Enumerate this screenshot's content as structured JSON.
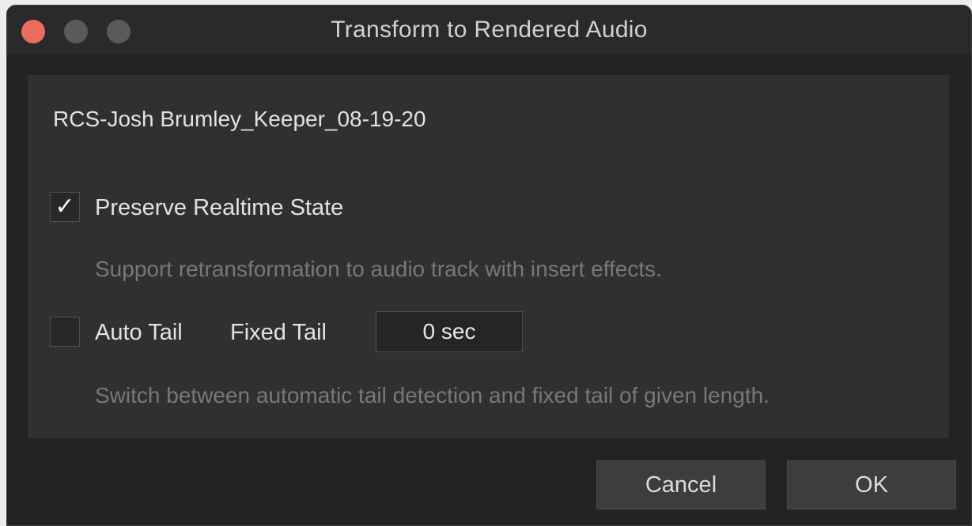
{
  "window": {
    "title": "Transform to Rendered Audio"
  },
  "clip": {
    "name": "RCS-Josh Brumley_Keeper_08-19-20"
  },
  "options": {
    "preserve_realtime": {
      "label": "Preserve Realtime State",
      "checked": true,
      "check_glyph": "✓",
      "hint": "Support retransformation to audio track with insert effects."
    },
    "tail": {
      "auto_label": "Auto Tail",
      "auto_checked": false,
      "fixed_label": "Fixed Tail",
      "fixed_value": "0 sec",
      "hint": "Switch between automatic tail detection and fixed tail of given length."
    }
  },
  "buttons": {
    "cancel": "Cancel",
    "ok": "OK"
  },
  "colors": {
    "close": "#ed6a5e",
    "inactive_traffic": "#5a5a5c",
    "window_bg": "#232323",
    "panel_bg": "#2f3032"
  }
}
